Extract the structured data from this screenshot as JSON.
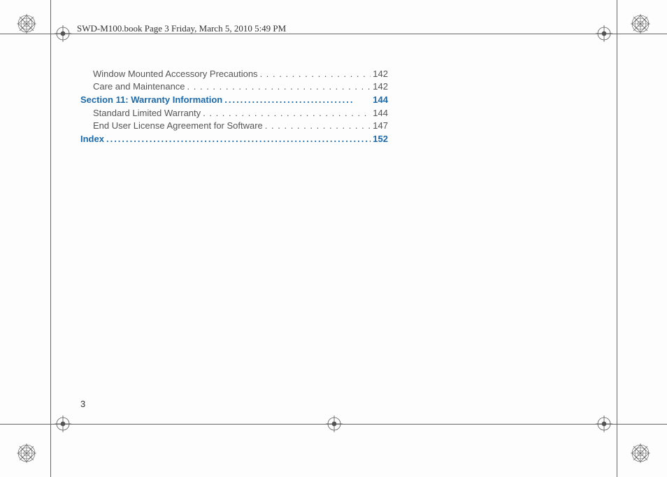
{
  "header": "SWD-M100.book  Page 3  Friday, March 5, 2010  5:49 PM",
  "toc": {
    "sub_before": [
      {
        "title": "Window Mounted Accessory Precautions",
        "page": "142"
      },
      {
        "title": "Care and Maintenance",
        "page": "142"
      }
    ],
    "section11": {
      "title": "Section 11:  Warranty Information",
      "page": "144"
    },
    "section11_subs": [
      {
        "title": "Standard Limited Warranty",
        "page": "144"
      },
      {
        "title": "End User License Agreement for Software",
        "page": "147"
      }
    ],
    "index_line": {
      "title": "Index",
      "page": "152"
    }
  },
  "page_number": "3"
}
